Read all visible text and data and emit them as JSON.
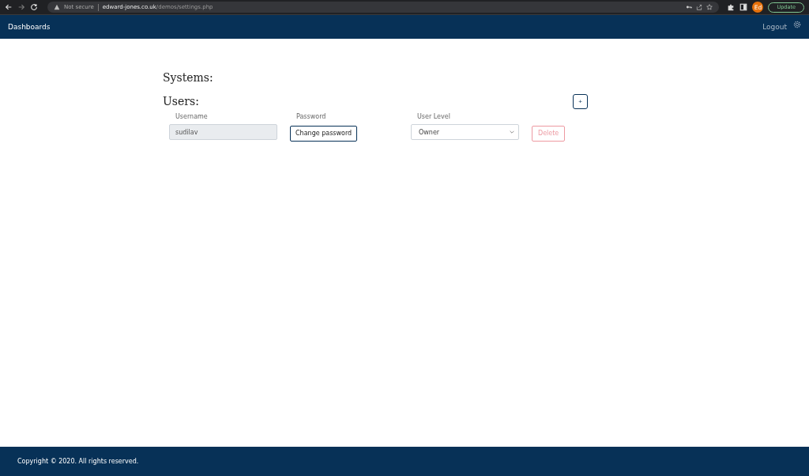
{
  "browser": {
    "security": "Not secure",
    "url_host": "edward-jones.co.uk",
    "url_path": "/demos/settings.php",
    "profile": "Ed",
    "update_button": "Update"
  },
  "navbar": {
    "brand": "Dashboards",
    "logout": "Logout"
  },
  "sections": [
    {
      "title": "Systems:"
    },
    {
      "title": "Users:",
      "add_button": "+"
    }
  ],
  "users": {
    "columns": [
      "Username",
      "Password",
      "User Level"
    ],
    "rows": [
      {
        "username": "sudilav",
        "username_disabled": true,
        "password_button": "Change password",
        "level": "Owner",
        "delete_button": "Delete",
        "delete_disabled": true
      }
    ]
  },
  "footer": {
    "text": "Copyright © 2020. All rights reserved."
  }
}
